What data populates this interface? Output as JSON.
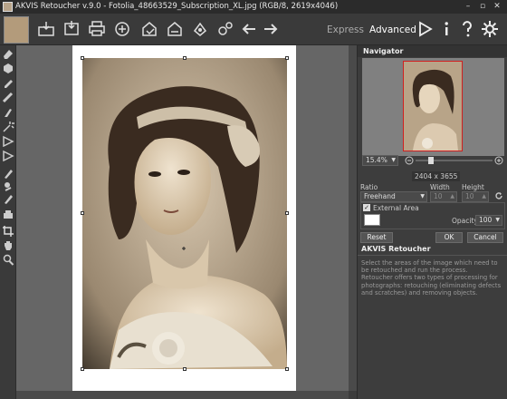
{
  "window": {
    "title": "AKVIS Retoucher v.9.0 - Fotolia_48663529_Subscription_XL.jpg (RGB/8, 2619x4046)",
    "controls": [
      "–",
      "▫",
      "✕"
    ]
  },
  "toolbar": {
    "icons": [
      "open-image-icon",
      "save-icon",
      "print-icon",
      "share-icon",
      "batch-icon",
      "export-icon",
      "run-icon",
      "preferences-icon",
      "undo-icon",
      "redo-icon"
    ],
    "modes": {
      "express": "Express",
      "advanced": "Advanced"
    },
    "right_icons": [
      "play-icon",
      "info-icon",
      "help-icon",
      "settings-icon"
    ],
    "accent": "#f0f0f0"
  },
  "tools": [
    "eraser-icon",
    "healing-icon",
    "stamp-icon",
    "clone-icon",
    "brush-icon",
    "magic-wand-icon",
    "lasso-icon",
    "polygon-lasso-icon",
    "pencil-icon",
    "chameleon-icon",
    "smart-brush-icon",
    "patch-icon",
    "crop-icon",
    "hand-icon",
    "zoom-icon"
  ],
  "navigator": {
    "title": "Navigator",
    "zoom": "15.4%",
    "size_readout": "2404 x 3655"
  },
  "crop": {
    "ratio_label": "Ratio",
    "width_label": "Width",
    "height_label": "Height",
    "ratio_value": "Freehand",
    "width_value": "10",
    "height_value": "10",
    "external_area_label": "External Area",
    "external_area_checked": true,
    "opacity_label": "Opacity",
    "opacity_value": "100",
    "reset": "Reset",
    "ok": "OK",
    "cancel": "Cancel"
  },
  "help": {
    "title": "AKVIS Retoucher",
    "body": "Select the areas of the image which need to be retouched and run the process.\nRetoucher offers two types of processing for photographs: retouching (eliminating defects and scratches) and removing objects."
  }
}
